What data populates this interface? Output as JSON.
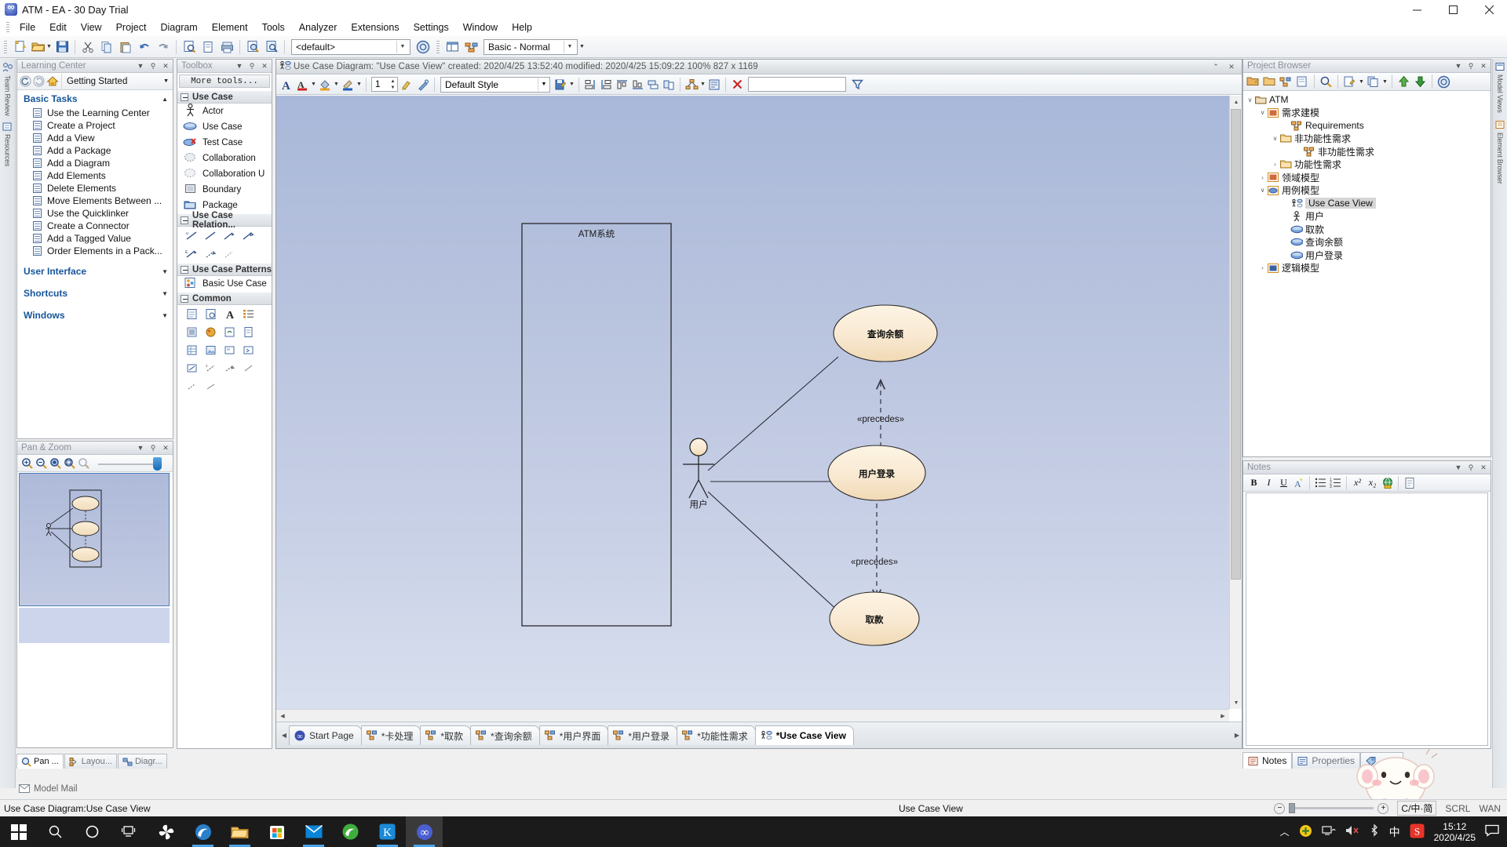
{
  "window": {
    "title": "ATM - EA - 30 Day Trial",
    "minimize": "—",
    "maximize": "☐",
    "close": "✕"
  },
  "menubar": {
    "items": [
      "File",
      "Edit",
      "View",
      "Project",
      "Diagram",
      "Element",
      "Tools",
      "Analyzer",
      "Extensions",
      "Settings",
      "Window",
      "Help"
    ]
  },
  "main_toolbar": {
    "perspective_value": "<default>",
    "technology_value": "Basic - Normal",
    "buttons": [
      "new-project",
      "open-project",
      "save-project",
      "cut",
      "copy",
      "paste",
      "undo",
      "redo",
      "search-project",
      "new-diagram",
      "print",
      "zoom-find",
      "model-search"
    ]
  },
  "left_edge_tabs": [
    "Team Review",
    "Resources"
  ],
  "right_edge_tabs": [
    "Model Views",
    "Element Browser"
  ],
  "learning_center": {
    "title": "Learning Center",
    "nav": {
      "back": "←",
      "forward": "→",
      "home": "home-icon"
    },
    "combo_value": "Getting Started",
    "sections": [
      {
        "label": "Basic Tasks",
        "items": [
          "Use the Learning Center",
          "Create a Project",
          "Add a View",
          "Add a Package",
          "Add a Diagram",
          "Add Elements",
          "Delete Elements",
          "Move Elements Between ...",
          "Use the Quicklinker",
          "Create a Connector",
          "Add a Tagged Value",
          "Order Elements in a Pack..."
        ]
      },
      {
        "label": "User Interface",
        "items": []
      },
      {
        "label": "Shortcuts",
        "items": []
      },
      {
        "label": "Windows",
        "items": []
      }
    ]
  },
  "pan_zoom": {
    "title": "Pan & Zoom",
    "tools": [
      "zoom-in",
      "zoom-out",
      "zoom-fit",
      "zoom-selection",
      "zoom-reset"
    ]
  },
  "left_bottom_tabs": [
    {
      "label": "Pan ...",
      "active": true,
      "icon": "magnifier-icon"
    },
    {
      "label": "Layou...",
      "active": false,
      "icon": "layout-icon"
    },
    {
      "label": "Diagr...",
      "active": false,
      "icon": "diagram-icon"
    }
  ],
  "model_mail": "Model Mail",
  "toolbox": {
    "title": "Toolbox",
    "more_tools": "More tools...",
    "groups": [
      {
        "label": "Use Case",
        "items": [
          {
            "label": "Actor",
            "icon": "actor-icon"
          },
          {
            "label": "Use Case",
            "icon": "usecase-icon"
          },
          {
            "label": "Test Case",
            "icon": "testcase-icon"
          },
          {
            "label": "Collaboration",
            "icon": "collaboration-icon"
          },
          {
            "label": "Collaboration U",
            "icon": "collaboration-use-icon"
          },
          {
            "label": "Boundary",
            "icon": "boundary-icon"
          },
          {
            "label": "Package",
            "icon": "package-icon"
          }
        ]
      },
      {
        "label": "Use Case Relation...",
        "items": []
      },
      {
        "label": "Use Case Patterns",
        "items": [
          {
            "label": "Basic Use Case",
            "icon": "pattern-icon"
          }
        ]
      },
      {
        "label": "Common",
        "items": []
      }
    ]
  },
  "diagram": {
    "header": {
      "icon": "usecase-diagram-icon",
      "text": "Use Case Diagram: \"Use Case View\"   created: 2020/4/25 13:52:40  modified: 2020/4/25 15:09:22    100%   827 x 1169",
      "restore": "⌃",
      "close": "✕"
    },
    "toolbar": {
      "font_label": "A",
      "line_width_value": "1",
      "style_value": "Default Style",
      "search_value": ""
    },
    "tabs": [
      {
        "label": "Start Page",
        "active": false,
        "icon": "ea-icon"
      },
      {
        "label": "*卡处理",
        "active": false,
        "icon": "usecase-diagram-icon"
      },
      {
        "label": "*取款",
        "active": false,
        "icon": "usecase-diagram-icon"
      },
      {
        "label": "*查询余额",
        "active": false,
        "icon": "usecase-diagram-icon"
      },
      {
        "label": "*用户界面",
        "active": false,
        "icon": "usecase-diagram-icon"
      },
      {
        "label": "*用户登录",
        "active": false,
        "icon": "usecase-diagram-icon"
      },
      {
        "label": "*功能性需求",
        "active": false,
        "icon": "usecase-diagram-icon"
      },
      {
        "label": "*Use Case View",
        "active": true,
        "icon": "usecase-view-icon"
      }
    ]
  },
  "chart_data": {
    "type": "diagram",
    "diagram_type": "UML Use Case Diagram",
    "boundary": {
      "label": "ATM系统"
    },
    "actors": [
      {
        "name": "用户"
      }
    ],
    "use_cases": [
      {
        "name": "查询余额"
      },
      {
        "name": "用户登录"
      },
      {
        "name": "取款"
      }
    ],
    "associations": [
      {
        "from": "用户",
        "to": "查询余额"
      },
      {
        "from": "用户",
        "to": "用户登录"
      },
      {
        "from": "用户",
        "to": "取款"
      }
    ],
    "dependencies": [
      {
        "from": "用户登录",
        "to": "查询余额",
        "stereotype": "«precedes»"
      },
      {
        "from": "用户登录",
        "to": "取款",
        "stereotype": "«precedes»"
      }
    ],
    "stereotype_label": "«precedes»"
  },
  "project_browser": {
    "title": "Project Browser",
    "tree": [
      {
        "label": "ATM",
        "depth": 0,
        "expander": "∨",
        "icon": "package-root-icon",
        "selected": false
      },
      {
        "label": "需求建模",
        "depth": 1,
        "expander": "∨",
        "icon": "view-icon",
        "selected": false
      },
      {
        "label": "Requirements",
        "depth": 2,
        "expander": "",
        "icon": "diagram-req-icon",
        "selected": false
      },
      {
        "label": "非功能性需求",
        "depth": 2,
        "expander": "∨",
        "icon": "folder-icon",
        "selected": false
      },
      {
        "label": "非功能性需求",
        "depth": 3,
        "expander": "",
        "icon": "diagram-req-icon",
        "selected": false
      },
      {
        "label": "功能性需求",
        "depth": 2,
        "expander": "›",
        "icon": "folder-icon",
        "selected": false
      },
      {
        "label": "领域模型",
        "depth": 1,
        "expander": "›",
        "icon": "view-icon",
        "selected": false
      },
      {
        "label": "用例模型",
        "depth": 1,
        "expander": "∨",
        "icon": "usecase-view-folder-icon",
        "selected": false
      },
      {
        "label": "Use Case View",
        "depth": 2,
        "expander": "",
        "icon": "usecase-view-icon",
        "selected": true
      },
      {
        "label": "用户",
        "depth": 2,
        "expander": "",
        "icon": "actor-icon",
        "selected": false
      },
      {
        "label": "取款",
        "depth": 2,
        "expander": "",
        "icon": "usecase-icon",
        "selected": false
      },
      {
        "label": "查询余额",
        "depth": 2,
        "expander": "",
        "icon": "usecase-icon",
        "selected": false
      },
      {
        "label": "用户登录",
        "depth": 2,
        "expander": "",
        "icon": "usecase-icon",
        "selected": false
      },
      {
        "label": "逻辑模型",
        "depth": 1,
        "expander": "›",
        "icon": "logical-view-icon",
        "selected": false
      }
    ]
  },
  "notes": {
    "title": "Notes",
    "toolbar": {
      "bold": "B",
      "italic": "I",
      "underline": "U",
      "font_color": "A",
      "bullet_list": "bullet-list-icon",
      "numbered_list": "numbered-list-icon",
      "superscript": "x²",
      "subscript": "x₂",
      "hyperlink": "globe-icon",
      "insert": "document-icon"
    },
    "content": ""
  },
  "notes_tabs": [
    {
      "label": "Notes",
      "active": true,
      "icon": "notes-icon"
    },
    {
      "label": "Properties",
      "active": false,
      "icon": "properties-icon"
    },
    {
      "label": "...es",
      "active": false,
      "icon": "tags-icon"
    }
  ],
  "statusbar": {
    "left": "Use Case Diagram:Use Case View",
    "center": "Use Case View",
    "zoom_minus": "−",
    "zoom_plus": "+",
    "ime": "C/中·简",
    "scroll_lock": "SCRL",
    "wan": "WAN"
  },
  "taskbar": {
    "apps": [
      {
        "name": "start-button",
        "icon": "windows-icon"
      },
      {
        "name": "search-button",
        "icon": "search-icon"
      },
      {
        "name": "cortana-button",
        "icon": "cortana-icon"
      },
      {
        "name": "task-view-button",
        "icon": "task-view-icon"
      },
      {
        "name": "app-fan",
        "icon": "fan-icon"
      },
      {
        "name": "app-edge",
        "icon": "edge-icon"
      },
      {
        "name": "app-explorer",
        "icon": "folder-icon"
      },
      {
        "name": "app-store",
        "icon": "store-icon"
      },
      {
        "name": "app-mail",
        "icon": "mail-icon"
      },
      {
        "name": "app-browser",
        "icon": "green-browser-icon"
      },
      {
        "name": "app-kugou",
        "icon": "kugou-icon"
      },
      {
        "name": "app-ea",
        "icon": "ea-icon"
      }
    ],
    "tray": [
      "show-hidden",
      "security-icon",
      "network-icon",
      "volume-icon",
      "bluetooth-icon",
      "ime-icon",
      "sogou-icon"
    ],
    "clock_time": "15:12",
    "clock_date": "2020/4/25",
    "notification": "notification-icon"
  }
}
